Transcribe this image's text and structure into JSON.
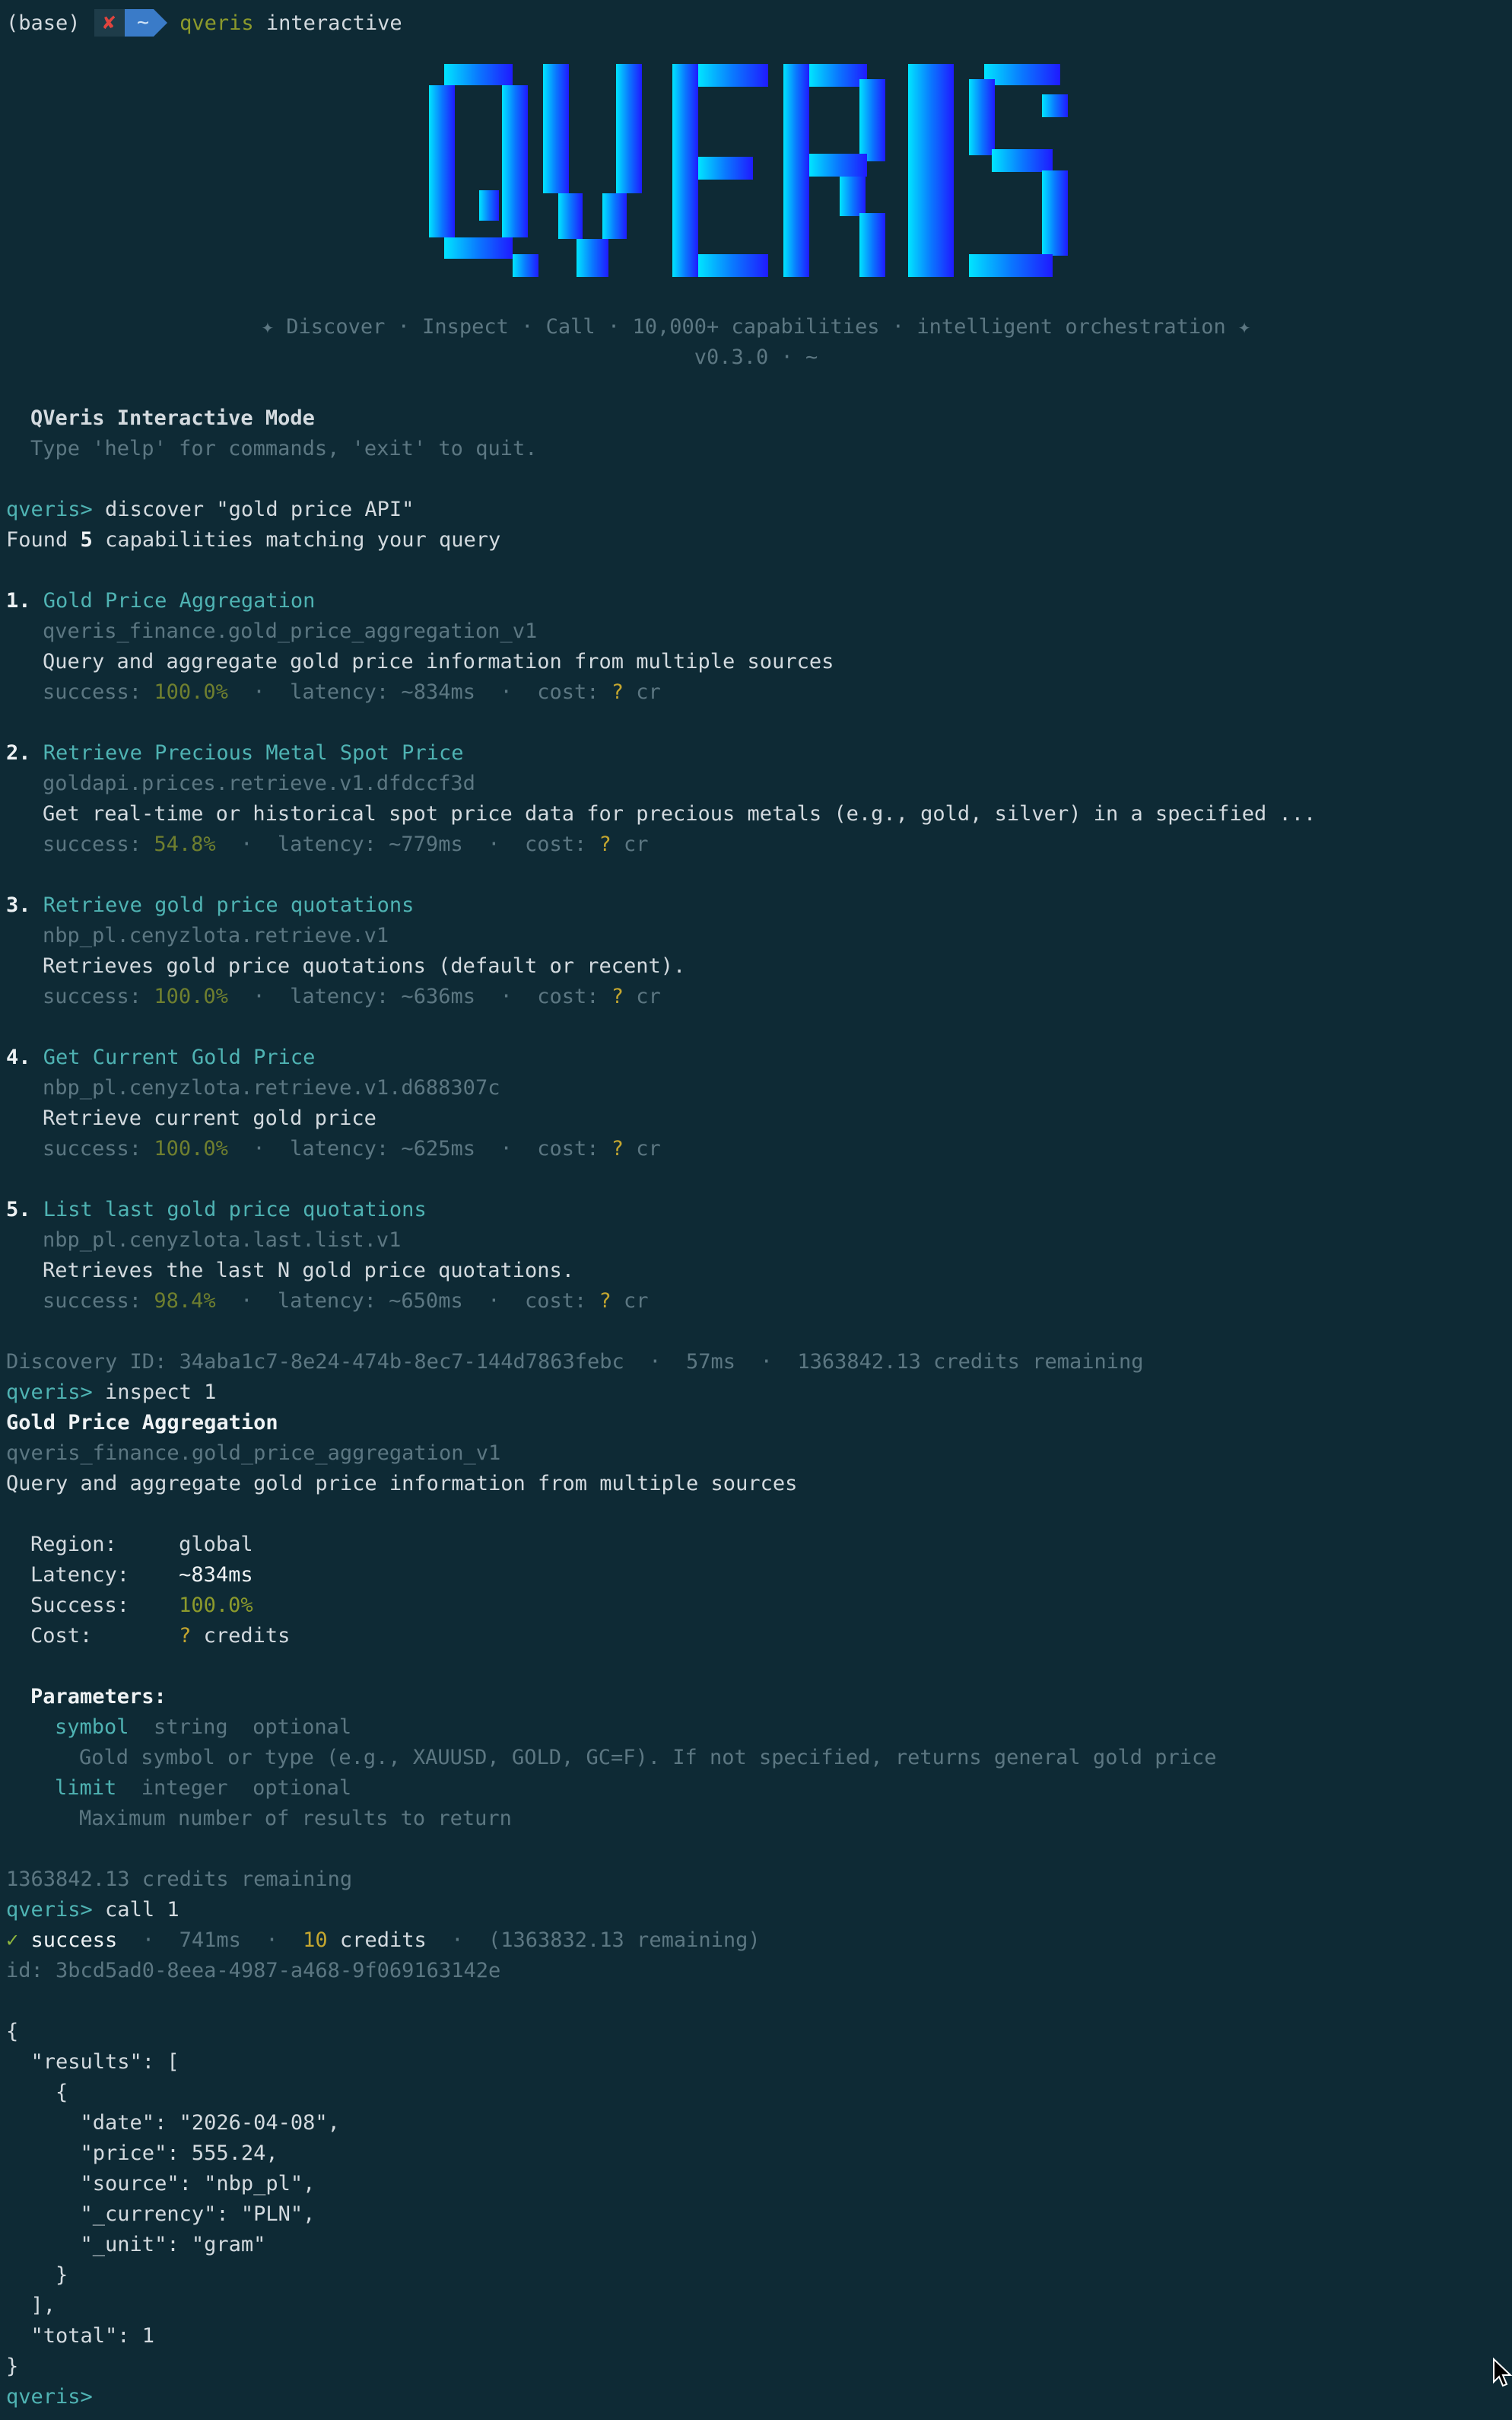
{
  "shell": {
    "env": "(base)",
    "status_icon": "✘",
    "dir": "~",
    "command_name": "qveris",
    "command_arg": " interactive"
  },
  "banner": {
    "logo_text": "QVERIS",
    "tagline": "✦ Discover · Inspect · Call · 10,000+ capabilities · intelligent orchestration ✦",
    "version": "v0.3.0 · ~"
  },
  "intro": {
    "title": "QVeris Interactive Mode",
    "hint": "Type 'help' for commands, 'exit' to quit."
  },
  "prompt_label": "qveris>",
  "discover": {
    "command": " discover \"gold price API\"",
    "found_prefix": "Found ",
    "found_count": "5",
    "found_suffix": " capabilities matching your query",
    "results": [
      {
        "num": "1.",
        "title": "Gold Price Aggregation",
        "id": "qveris_finance.gold_price_aggregation_v1",
        "desc": "Query and aggregate gold price information from multiple sources",
        "success_label": "success: ",
        "success": "100.0%",
        "latency": "  ·  latency: ~834ms  ·  cost: ",
        "cost": "?",
        "cost_unit": " cr"
      },
      {
        "num": "2.",
        "title": "Retrieve Precious Metal Spot Price",
        "id": "goldapi.prices.retrieve.v1.dfdccf3d",
        "desc": "Get real-time or historical spot price data for precious metals (e.g., gold, silver) in a specified ...",
        "success_label": "success: ",
        "success": "54.8%",
        "latency": "  ·  latency: ~779ms  ·  cost: ",
        "cost": "?",
        "cost_unit": " cr"
      },
      {
        "num": "3.",
        "title": "Retrieve gold price quotations",
        "id": "nbp_pl.cenyzlota.retrieve.v1",
        "desc": "Retrieves gold price quotations (default or recent).",
        "success_label": "success: ",
        "success": "100.0%",
        "latency": "  ·  latency: ~636ms  ·  cost: ",
        "cost": "?",
        "cost_unit": " cr"
      },
      {
        "num": "4.",
        "title": "Get Current Gold Price",
        "id": "nbp_pl.cenyzlota.retrieve.v1.d688307c",
        "desc": "Retrieve current gold price",
        "success_label": "success: ",
        "success": "100.0%",
        "latency": "  ·  latency: ~625ms  ·  cost: ",
        "cost": "?",
        "cost_unit": " cr"
      },
      {
        "num": "5.",
        "title": "List last gold price quotations",
        "id": "nbp_pl.cenyzlota.last.list.v1",
        "desc": "Retrieves the last N gold price quotations.",
        "success_label": "success: ",
        "success": "98.4%",
        "latency": "  ·  latency: ~650ms  ·  cost: ",
        "cost": "?",
        "cost_unit": " cr"
      }
    ],
    "footer": "Discovery ID: 34aba1c7-8e24-474b-8ec7-144d7863febc  ·  57ms  ·  1363842.13 credits remaining"
  },
  "inspect": {
    "command": " inspect 1",
    "title": "Gold Price Aggregation",
    "id": "qveris_finance.gold_price_aggregation_v1",
    "desc": "Query and aggregate gold price information from multiple sources",
    "fields": {
      "region_label": "Region:     ",
      "region": "global",
      "latency_label": "Latency:    ",
      "latency": "~834ms",
      "success_label": "Success:    ",
      "success": "100.0%",
      "cost_label": "Cost:       ",
      "cost": "?",
      "cost_unit": " credits"
    },
    "params_label": "Parameters:",
    "params": [
      {
        "name": "symbol",
        "meta": "  string  optional",
        "desc": "Gold symbol or type (e.g., XAUUSD, GOLD, GC=F). If not specified, returns general gold price"
      },
      {
        "name": "limit",
        "meta": "  integer  optional",
        "desc": "Maximum number of results to return"
      }
    ],
    "footer": "1363842.13 credits remaining"
  },
  "call": {
    "command": " call 1",
    "check": "✓ ",
    "status": "success",
    "time": "  ·  741ms  ·  ",
    "credits": "10",
    "credits_label": " credits",
    "remaining": "  ·  (1363832.13 remaining)",
    "id_line": "id: 3bcd5ad0-8eea-4987-a468-9f069163142e",
    "json_lines": [
      "{",
      "  \"results\": [",
      "    {",
      "      \"date\": \"2026-04-08\",",
      "      \"price\": 555.24,",
      "      \"source\": \"nbp_pl\",",
      "      \"_currency\": \"PLN\",",
      "      \"_unit\": \"gram\"",
      "    }",
      "  ],",
      "  \"total\": 1",
      "}"
    ]
  },
  "colors": {
    "background": "#0e2a35",
    "accent_teal": "#4fb3b3",
    "success_olive": "#8c9a2c",
    "cost_gold": "#c4a62f",
    "logo_gradient": [
      "#00e5ff",
      "#1f1aff"
    ]
  }
}
